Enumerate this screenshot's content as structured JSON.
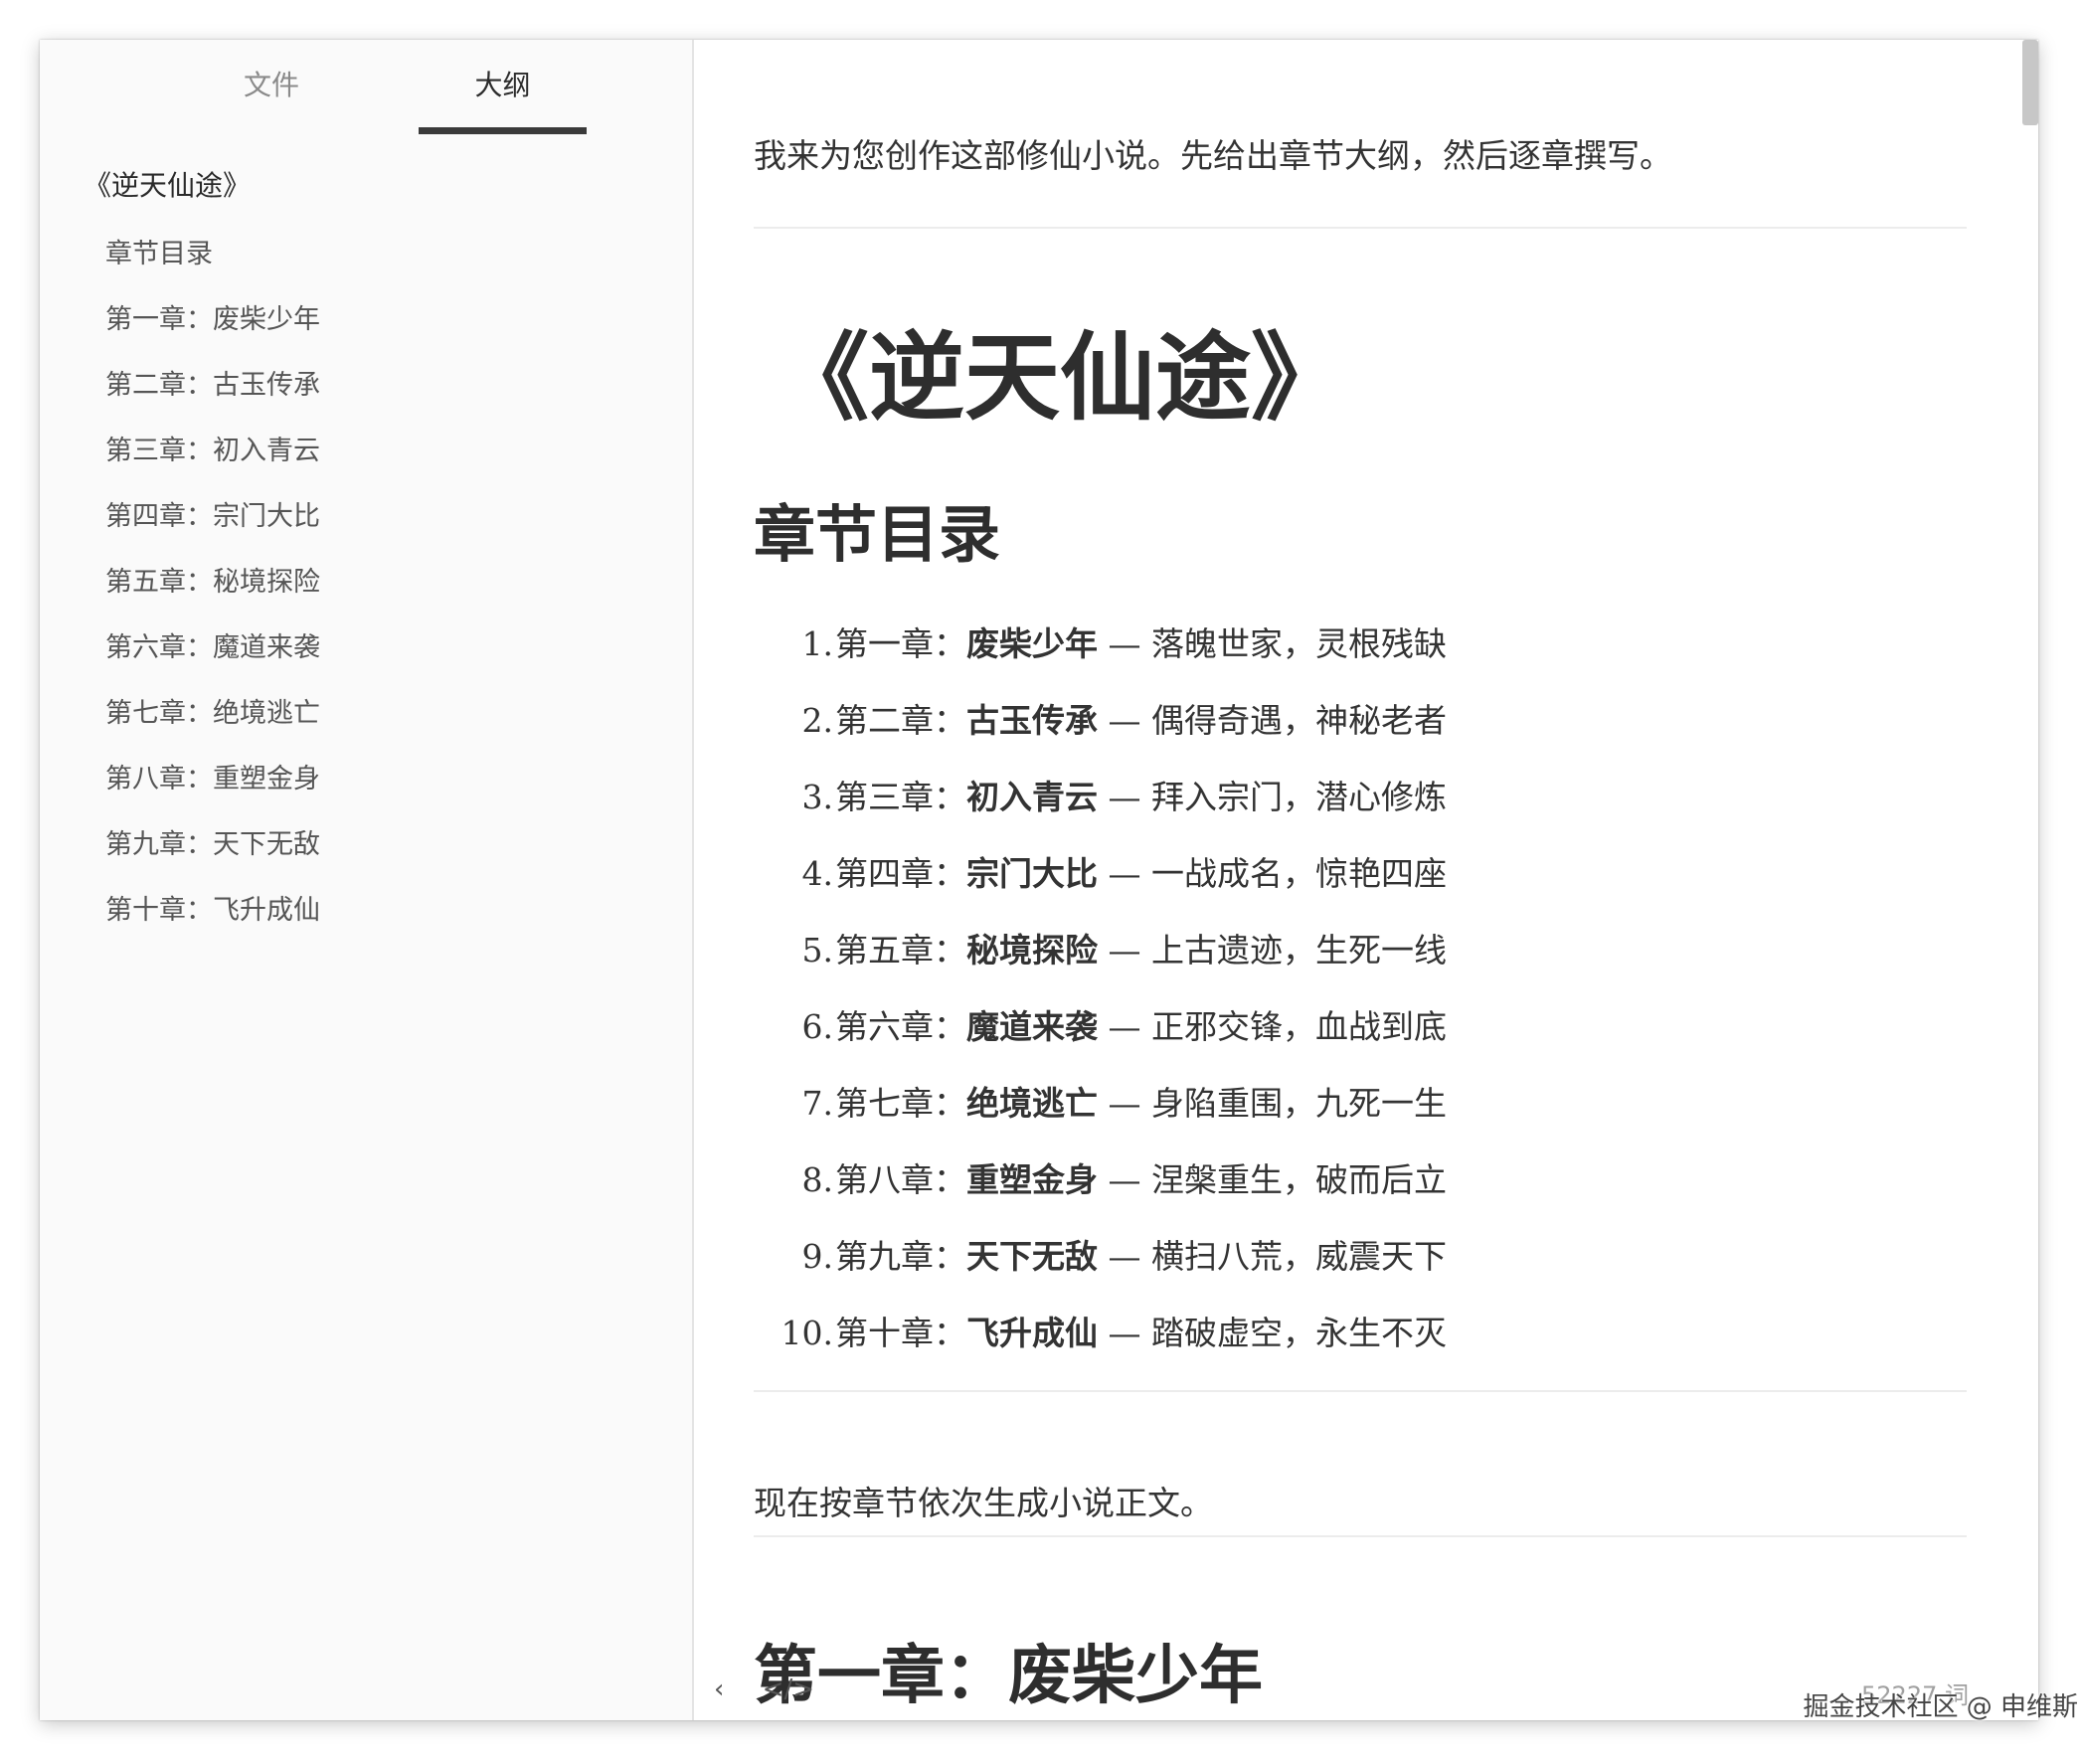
{
  "sidebar": {
    "tabs": [
      {
        "label": "文件",
        "active": false
      },
      {
        "label": "大纲",
        "active": true
      }
    ],
    "outline_title": "《逆天仙途》",
    "outline_items": [
      "章节目录",
      "第一章：废柴少年",
      "第二章：古玉传承",
      "第三章：初入青云",
      "第四章：宗门大比",
      "第五章：秘境探险",
      "第六章：魔道来袭",
      "第七章：绝境逃亡",
      "第八章：重塑金身",
      "第九章：天下无敌",
      "第十章：飞升成仙"
    ]
  },
  "main": {
    "intro": "我来为您创作这部修仙小说。先给出章节大纲，然后逐章撰写。",
    "book_title": "《逆天仙途》",
    "toc_heading": "章节目录",
    "toc": [
      {
        "num": "1.",
        "prefix": "第一章：",
        "name": "废柴少年",
        "desc": " — 落魄世家，灵根残缺"
      },
      {
        "num": "2.",
        "prefix": "第二章：",
        "name": "古玉传承",
        "desc": " — 偶得奇遇，神秘老者"
      },
      {
        "num": "3.",
        "prefix": "第三章：",
        "name": "初入青云",
        "desc": " — 拜入宗门，潜心修炼"
      },
      {
        "num": "4.",
        "prefix": "第四章：",
        "name": "宗门大比",
        "desc": " — 一战成名，惊艳四座"
      },
      {
        "num": "5.",
        "prefix": "第五章：",
        "name": "秘境探险",
        "desc": " — 上古遗迹，生死一线"
      },
      {
        "num": "6.",
        "prefix": "第六章：",
        "name": "魔道来袭",
        "desc": " — 正邪交锋，血战到底"
      },
      {
        "num": "7.",
        "prefix": "第七章：",
        "name": "绝境逃亡",
        "desc": " — 身陷重围，九死一生"
      },
      {
        "num": "8.",
        "prefix": "第八章：",
        "name": "重塑金身",
        "desc": " — 涅槃重生，破而后立"
      },
      {
        "num": "9.",
        "prefix": "第九章：",
        "name": "天下无敌",
        "desc": " — 横扫八荒，威震天下"
      },
      {
        "num": "10.",
        "prefix": "第十章：",
        "name": "飞升成仙",
        "desc": " — 踏破虚空，永生不灭"
      }
    ],
    "paragraph2": "现在按章节依次生成小说正文。",
    "chapter1_heading": "第一章：废柴少年"
  },
  "footer": {
    "back_glyph": "‹",
    "code_glyph": "</>",
    "word_count": "52227 词"
  },
  "watermark": "掘金技术社区 @ 申维斯",
  "icons": {
    "back": "chevron-left-icon",
    "source": "code-icon"
  }
}
